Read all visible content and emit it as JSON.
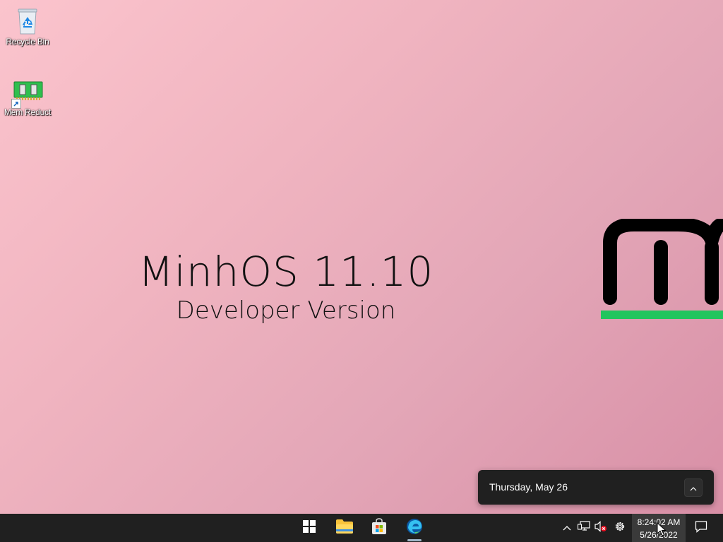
{
  "desktop": {
    "icons": [
      {
        "label": "Recycle Bin",
        "icon": "recycle-bin-icon"
      },
      {
        "label": "Mem Reduct",
        "icon": "mem-reduct-icon",
        "shortcut": true
      }
    ],
    "branding": {
      "os_name": "MinhOS 11.10",
      "edition": "Developer Version",
      "logo": "minhos-m-logo",
      "logo_underline_color": "#22c55e"
    },
    "background_colors": [
      "#fbc4cd",
      "#d88fa6"
    ]
  },
  "notification": {
    "date": "Thursday, May 26",
    "collapse_icon": "chevron-up-icon"
  },
  "taskbar": {
    "apps": [
      {
        "name": "start",
        "icon": "windows-start-icon"
      },
      {
        "name": "file-explorer",
        "icon": "folder-icon"
      },
      {
        "name": "microsoft-store",
        "icon": "store-icon"
      },
      {
        "name": "edge",
        "icon": "edge-browser-icon",
        "active": true
      }
    ],
    "tray": [
      {
        "name": "show-hidden",
        "icon": "chevron-up-icon"
      },
      {
        "name": "network",
        "icon": "network-disconnected-icon"
      },
      {
        "name": "volume",
        "icon": "volume-muted-icon"
      },
      {
        "name": "settings",
        "icon": "gear-icon"
      }
    ],
    "clock": {
      "time": "8:24:02 AM",
      "date": "5/26/2022"
    },
    "notification_center_icon": "notification-icon"
  },
  "colors": {
    "taskbar": "#202020",
    "accent_green": "#22c55e",
    "text_dark": "#111111"
  }
}
